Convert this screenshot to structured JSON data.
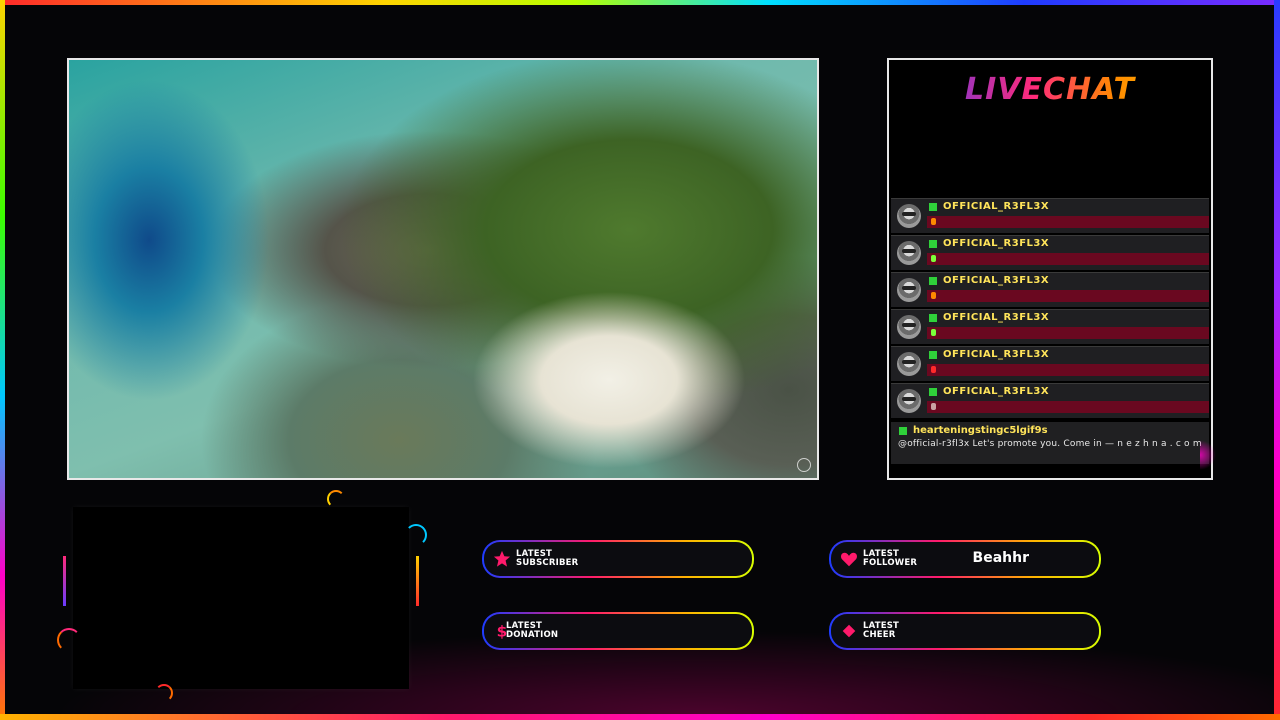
{
  "chat": {
    "title": "LIVECHAT",
    "messages": [
      {
        "user": "OFFICIAL_R3FL3X",
        "emote_color": "#ff8a00"
      },
      {
        "user": "OFFICIAL_R3FL3X",
        "emote_color": "#7cff3a"
      },
      {
        "user": "OFFICIAL_R3FL3X",
        "emote_color": "#ff8a00"
      },
      {
        "user": "OFFICIAL_R3FL3X",
        "emote_color": "#7cff3a"
      },
      {
        "user": "OFFICIAL_R3FL3X",
        "emote_color": "#ff2a2a"
      },
      {
        "user": "OFFICIAL_R3FL3X",
        "emote_color": "#c9a3a3"
      }
    ],
    "last_message": {
      "user": "hearteningstingc5lgif9s",
      "text": "@official-r3fl3x Let's promote you. Come in — n e z h n a . c o m"
    }
  },
  "alerts": {
    "subscriber": {
      "label_line1": "LATEST",
      "label_line2": "SUBSCRIBER",
      "value": ""
    },
    "follower": {
      "label_line1": "LATEST",
      "label_line2": "FOLLOWER",
      "value": "Beahhr"
    },
    "donation": {
      "label_line1": "LATEST",
      "label_line2": "DONATION",
      "value": ""
    },
    "cheer": {
      "label_line1": "LATEST",
      "label_line2": "CHEER",
      "value": ""
    }
  },
  "icons": {
    "subscriber": "star-icon",
    "follower": "heart-icon",
    "donation": "dollar-icon",
    "cheer": "diamond-icon"
  },
  "colors": {
    "chat_name": "#ffe45a",
    "chat_bar": "#6a0820",
    "badge": "#2fd13a",
    "icon_pink": "#ff1a6b"
  }
}
